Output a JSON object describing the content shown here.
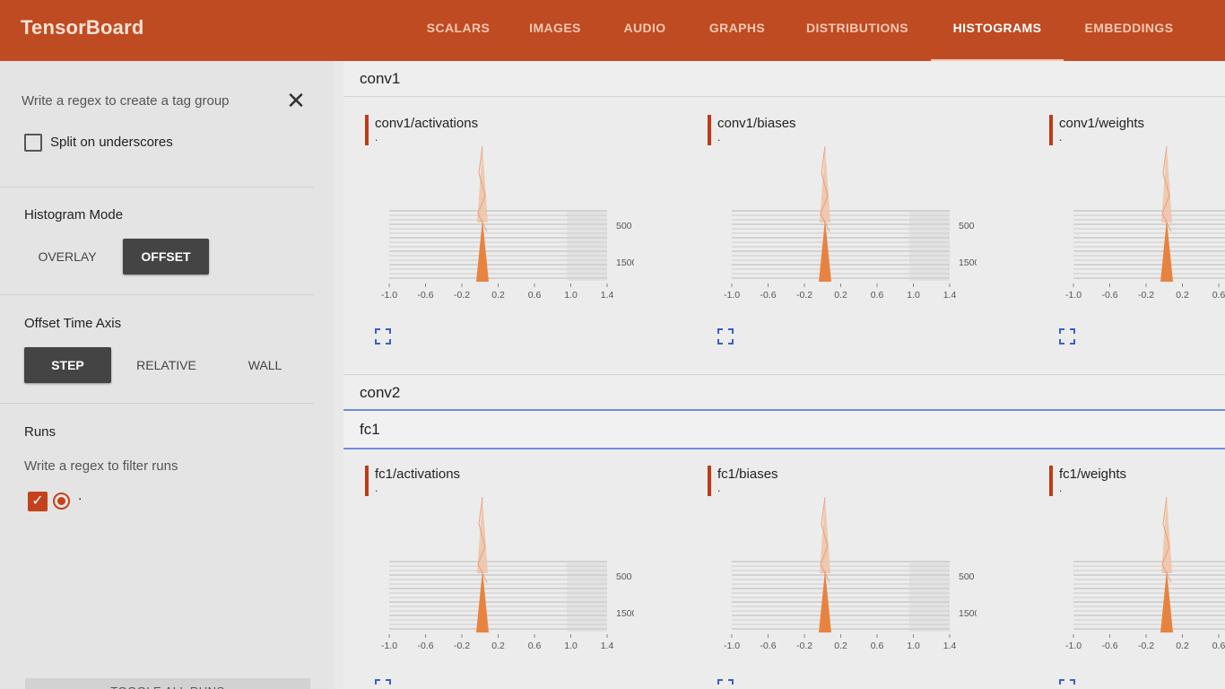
{
  "app": {
    "title": "TensorBoard"
  },
  "nav": {
    "tabs": [
      "SCALARS",
      "IMAGES",
      "AUDIO",
      "GRAPHS",
      "DISTRIBUTIONS",
      "HISTOGRAMS",
      "EMBEDDINGS"
    ],
    "active": "HISTOGRAMS"
  },
  "sidebar": {
    "tag_regex_placeholder": "Write a regex to create a tag group",
    "split_underscores_label": "Split on underscores",
    "histogram_mode": {
      "title": "Histogram Mode",
      "options": [
        "OVERLAY",
        "OFFSET"
      ],
      "selected": "OFFSET"
    },
    "offset_time_axis": {
      "title": "Offset Time Axis",
      "options": [
        "STEP",
        "RELATIVE",
        "WALL"
      ],
      "selected": "STEP"
    },
    "runs": {
      "title": "Runs",
      "filter_placeholder": "Write a regex to filter runs",
      "items": [
        {
          "name": ".",
          "checked": true,
          "selected": true
        }
      ]
    },
    "toggle_all_label": "TOGGLE ALL RUNS"
  },
  "groups": [
    {
      "name": "conv1",
      "cards": [
        {
          "title": "conv1/activations",
          "run": "."
        },
        {
          "title": "conv1/biases",
          "run": "."
        },
        {
          "title": "conv1/weights",
          "run": "."
        }
      ]
    },
    {
      "name": "conv2",
      "cards": []
    },
    {
      "name": "fc1",
      "cards": [
        {
          "title": "fc1/activations",
          "run": "."
        },
        {
          "title": "fc1/biases",
          "run": "."
        },
        {
          "title": "fc1/weights",
          "run": "."
        }
      ]
    }
  ],
  "histogram_axis": {
    "x_ticks": [
      "-1.0",
      "-0.6",
      "-0.2",
      "0.2",
      "0.6",
      "1.0",
      "1.4"
    ],
    "y_ticks": [
      "500",
      "1500"
    ]
  },
  "colors": {
    "header": "#bf4b22",
    "accent": "#bf3b17",
    "histogram": "#e8833f",
    "focus": "#6d8fd9"
  },
  "icons": {
    "close": "close-icon",
    "expand": "fullscreen-icon"
  }
}
